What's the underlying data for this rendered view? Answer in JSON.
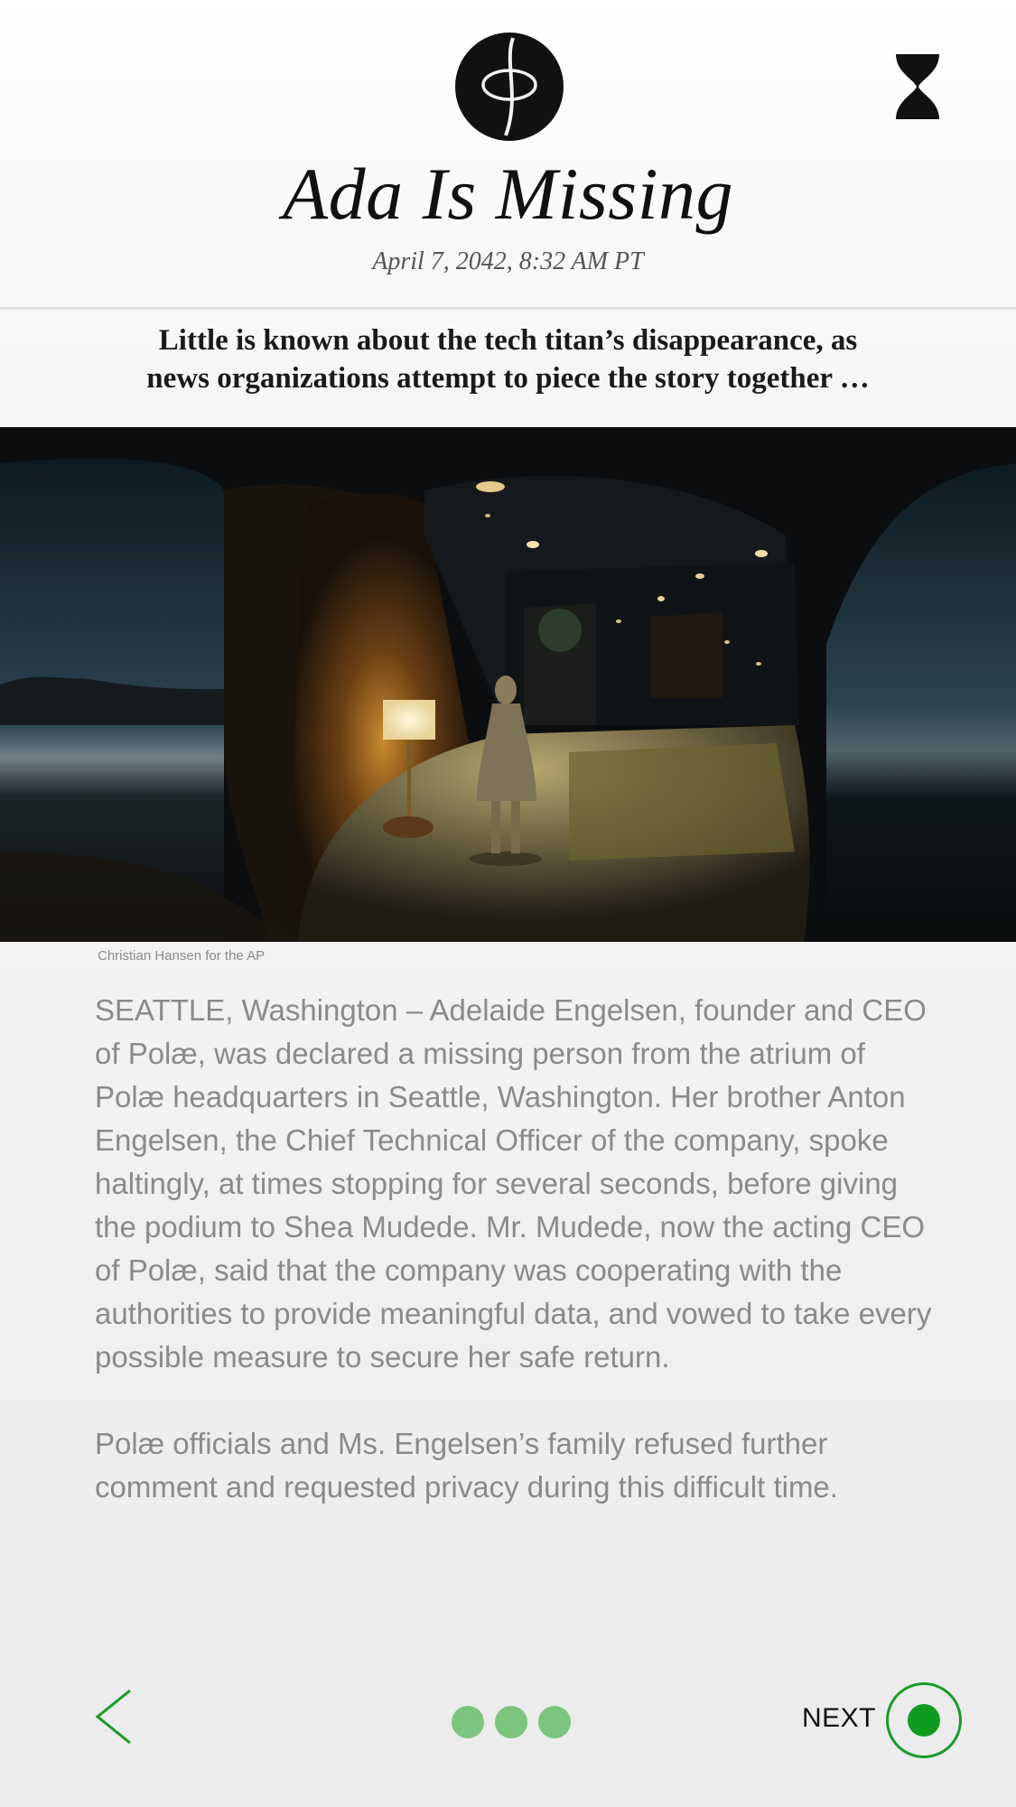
{
  "header": {
    "logo_icon": "phi-circle-logo-icon",
    "timer_icon": "hourglass-icon",
    "title": "Ada Is Missing",
    "dateline": "April 7, 2042, 8:32 AM PT"
  },
  "subhead": {
    "line1": "Little is known about the tech titan’s disappearance, as",
    "line2": "news organizations attempt to piece the story together …"
  },
  "image": {
    "credit": "Christian Hansen for the AP"
  },
  "article": {
    "paragraphs": [
      "SEATTLE, Washington – Adelaide Engelsen, founder and CEO of Polæ, was declared a missing person  from the atrium of Polæ headquarters in Seattle, Washington. Her brother Anton Engelsen, the Chief Technical Officer of the company, spoke haltingly, at times stopping for several seconds, before giving the podium to Shea Mudede.  Mr. Mudede, now the acting CEO of Polæ, said that the company was cooperating with the authorities to provide meaningful data, and vowed to take every possible measure to secure her safe return.",
      "Polæ officials and Ms. Engelsen’s family refused further comment and requested privacy during this difficult time."
    ]
  },
  "footer": {
    "back_icon": "chevron-left-icon",
    "next_label": "NEXT",
    "next_icon": "record-circle-icon",
    "pager_count": 3
  },
  "colors": {
    "accent_green": "#0f9b1f",
    "pager_dot": "#7dc47f",
    "body_text": "#8a8a8a"
  }
}
